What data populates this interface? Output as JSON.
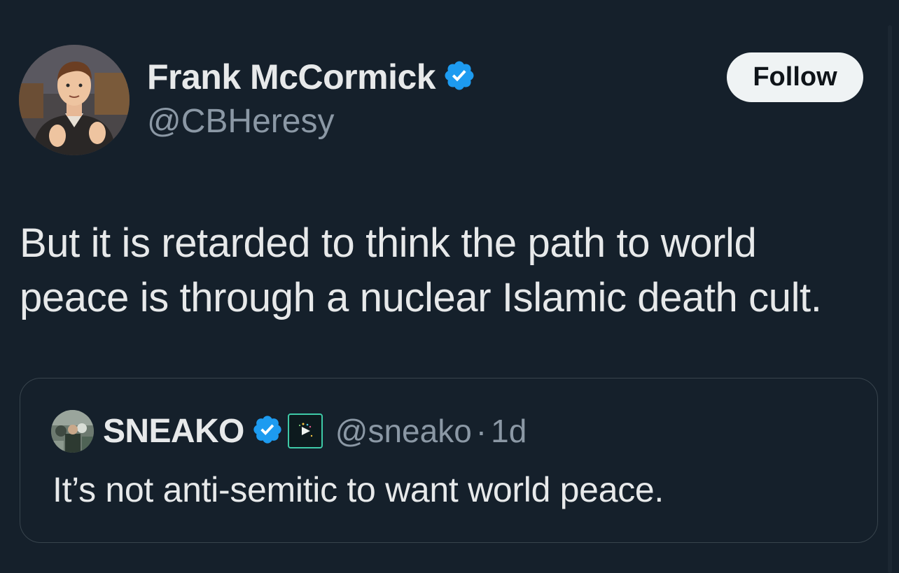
{
  "tweet": {
    "author": {
      "name": "Frank McCormick",
      "handle": "@CBHeresy",
      "verified": true
    },
    "follow_label": "Follow",
    "text": "But it is retarded to think the path to world peace is through a nuclear Islamic death cult."
  },
  "quoted_tweet": {
    "author": {
      "name": "SNEAKO",
      "handle": "@sneako",
      "verified": true
    },
    "separator": "·",
    "time": "1d",
    "text": "It’s not anti-semitic to want world peace."
  },
  "icons": {
    "verified": "verified-badge-icon",
    "affiliate": "affiliate-badge-icon"
  },
  "colors": {
    "background": "#15202b",
    "text": "#e7e9ea",
    "secondary_text": "#8b98a5",
    "verified_blue": "#1d9bf0",
    "follow_button_bg": "#eff3f4",
    "border": "#38444d"
  }
}
